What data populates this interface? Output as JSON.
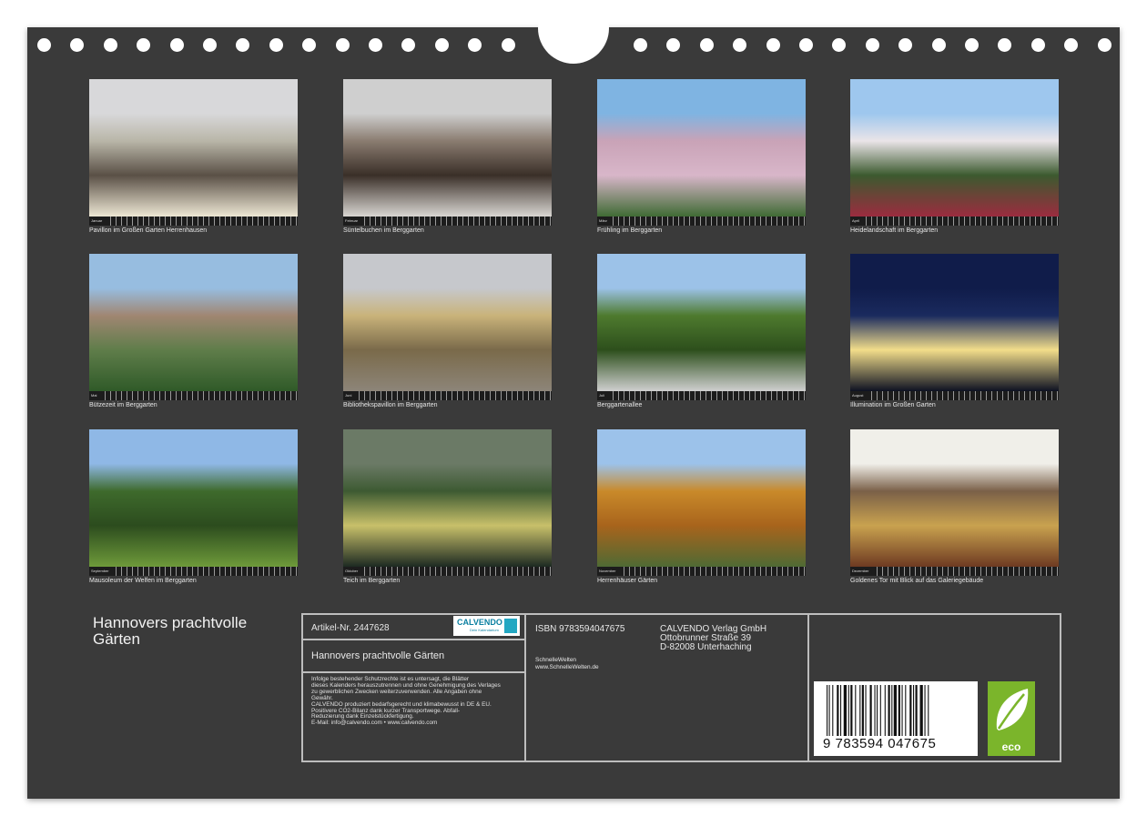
{
  "photos": [
    {
      "month": "Januar",
      "caption": "Pavillon im Großen Garten Herrenhausen",
      "colors": [
        "#d8d8da",
        "#b9b6a8",
        "#5a5046",
        "#ede7d4"
      ]
    },
    {
      "month": "Februar",
      "caption": "Süntelbuchen im Berggarten",
      "colors": [
        "#cfcfcf",
        "#8a7c70",
        "#3a2f28",
        "#d9d6d2"
      ]
    },
    {
      "month": "März",
      "caption": "Frühling im Berggarten",
      "colors": [
        "#7fb4e2",
        "#c9a3b7",
        "#d8b6c9",
        "#3f6b34"
      ]
    },
    {
      "month": "April",
      "caption": "Heidelandschaft im Berggarten",
      "colors": [
        "#9ec7ee",
        "#eae4e8",
        "#3c5a2f",
        "#9b2c3f"
      ]
    },
    {
      "month": "Mai",
      "caption": "Bützezeit im Berggarten",
      "colors": [
        "#97bde0",
        "#a08672",
        "#5f7d4a",
        "#2f5a28"
      ]
    },
    {
      "month": "Juni",
      "caption": "Bibliothekspavillon im Berggarten",
      "colors": [
        "#c6c8cc",
        "#c9b37a",
        "#7a6a4a",
        "#8d8579"
      ]
    },
    {
      "month": "Juli",
      "caption": "Berggartenallee",
      "colors": [
        "#9cc2e8",
        "#4e7a2e",
        "#2d4f1c",
        "#cfcfcf"
      ]
    },
    {
      "month": "August",
      "caption": "Illumination im Großen Garten",
      "colors": [
        "#101c4a",
        "#1a2a5e",
        "#f2dd8a",
        "#0e1222"
      ]
    },
    {
      "month": "September",
      "caption": "Mausoleum der Welfen im Berggarten",
      "colors": [
        "#8fb8e6",
        "#3e6a2c",
        "#2c4c1e",
        "#6e9a3a"
      ]
    },
    {
      "month": "Oktober",
      "caption": "Teich im Berggarten",
      "colors": [
        "#6b7a66",
        "#3d5a32",
        "#c8c06a",
        "#1d2a22"
      ]
    },
    {
      "month": "November",
      "caption": "Herrenhäuser Gärten",
      "colors": [
        "#9cc2ea",
        "#c98a2a",
        "#a8641c",
        "#4f6a34"
      ]
    },
    {
      "month": "Dezember",
      "caption": "Goldenes Tor mit Blick auf das Galeriegebäude",
      "colors": [
        "#f0efe9",
        "#7a6048",
        "#c9a24f",
        "#6e3a22"
      ]
    }
  ],
  "title": "Hannovers prachtvolle Gärten",
  "info": {
    "article": "Artikel-Nr. 2447628",
    "logo_name": "CALVENDO",
    "logo_tagline": "Dein Kalendarium",
    "calendar_title": "Hannovers prachtvolle Gärten",
    "legal_lines": [
      "Infolge bestehender Schutzrechte ist es untersagt, die Blätter",
      "dieses Kalenders herauszutrennen und ohne Genehmigung des Verlages",
      "zu gewerblichen Zwecken weiterzuverwenden. Alle Angaben ohne",
      "Gewähr.",
      "CALVENDO produziert bedarfsgerecht und klimabewusst in DE & EU.",
      "Positivere CO2-Bilanz dank kurzer Transportwege. Abfall-",
      "Reduzierung dank Einzelstückfertigung.",
      "E-Mail: info@calvendo.com • www.calvendo.com"
    ],
    "isbn": "ISBN 9783594047675",
    "publisher": [
      "CALVENDO Verlag GmbH",
      "Ottobrunner Straße 39",
      "D-82008 Unterhaching"
    ],
    "author_name": "SchnelleWelten",
    "author_url": "www.SchnelleWelten.de",
    "barcode_number": "9 783594 047675",
    "eco_label": "eco"
  }
}
